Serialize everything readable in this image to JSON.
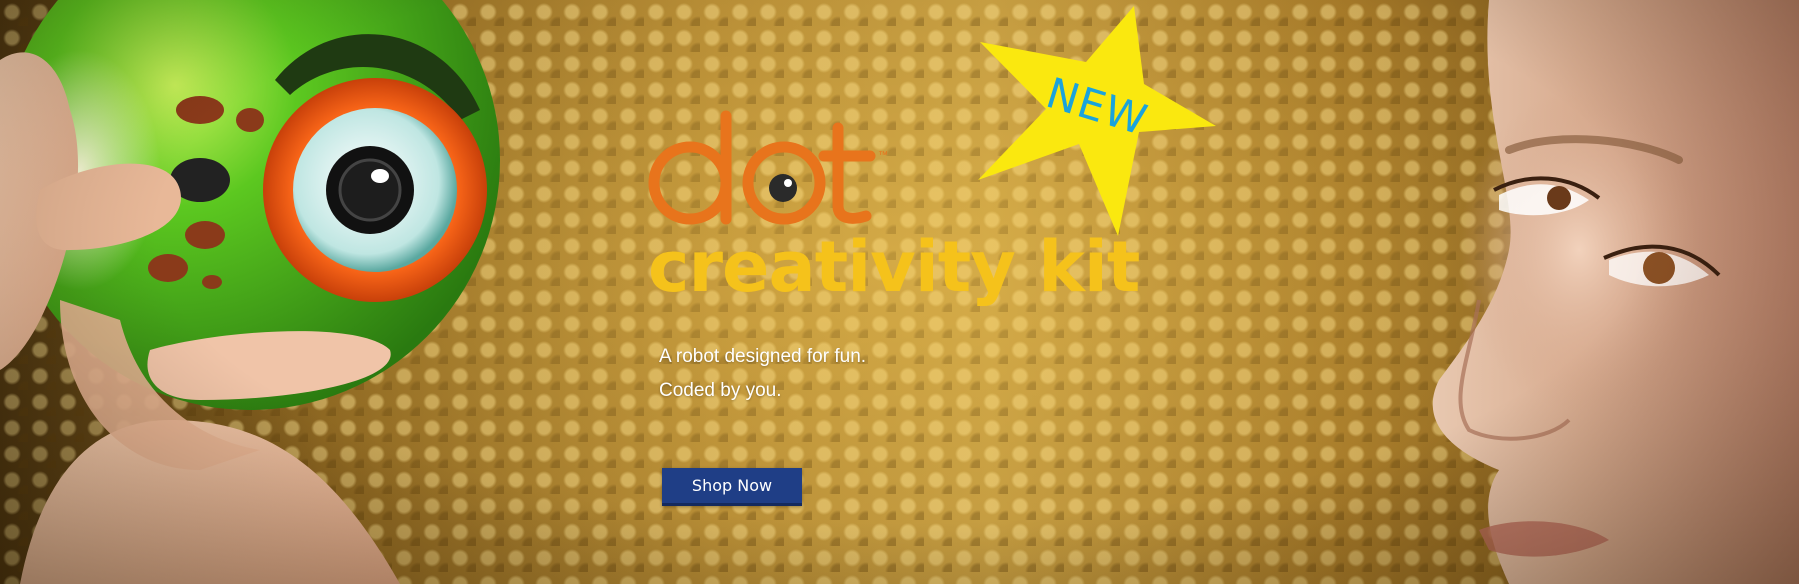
{
  "hero": {
    "logo_text": "dot",
    "trademark": "™",
    "kit_name": "creativity kit",
    "badge": "NEW",
    "tagline_line1": "A robot designed for fun.",
    "tagline_line2": "Coded by you.",
    "cta_label": "Shop Now"
  },
  "colors": {
    "logo_orange": "#e8741c",
    "kit_yellow": "#f5c21b",
    "star_yellow": "#fae80f",
    "badge_blue": "#1aa3dc",
    "button_blue": "#1f3e86"
  },
  "images": {
    "left": "hand-holding-robot-photo",
    "right": "child-face-photo"
  }
}
